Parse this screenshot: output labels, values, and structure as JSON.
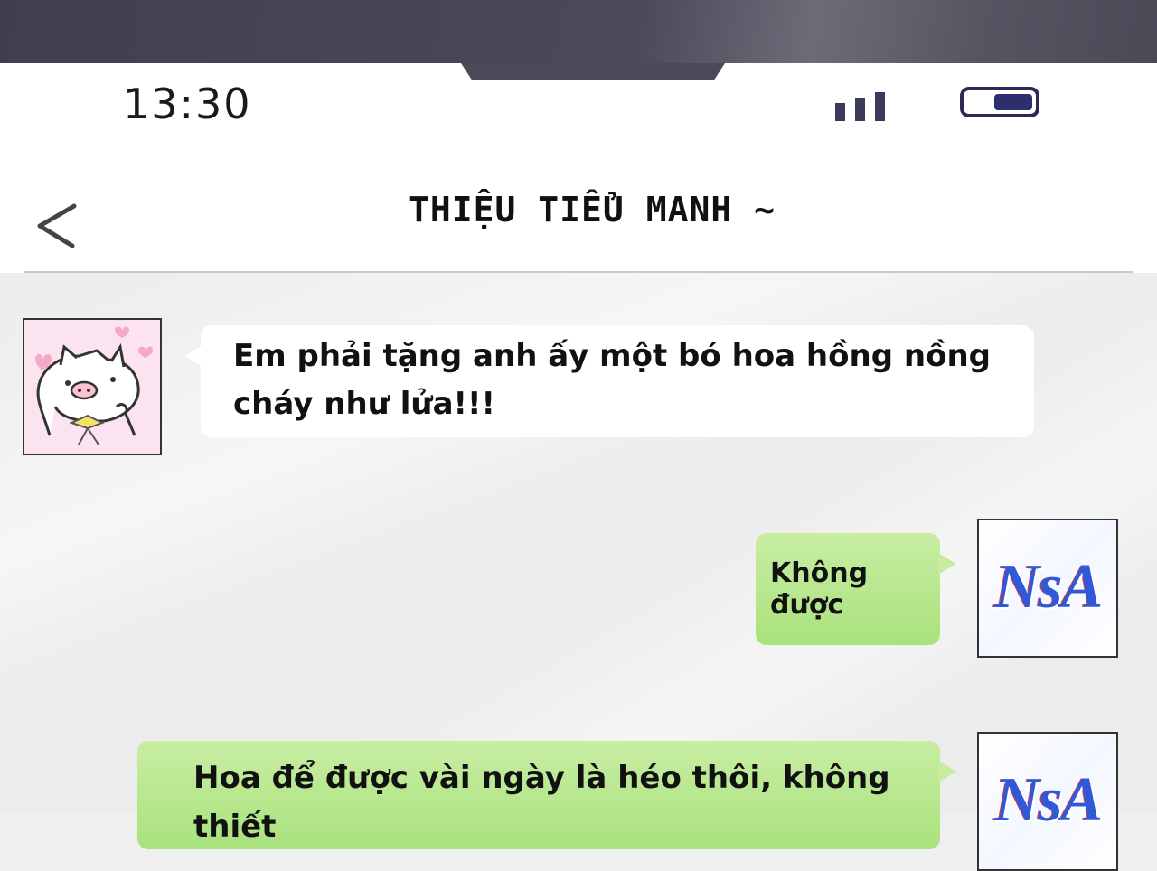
{
  "status_bar": {
    "time": "13:30",
    "icons": [
      "signal-icon",
      "battery-icon"
    ]
  },
  "header": {
    "title": "THIỆU TIỂU MANH ~",
    "back_icon": "chevron-left-icon"
  },
  "messages": [
    {
      "direction": "incoming",
      "avatar": "pig-avatar",
      "text": "Em phải tặng anh ấy một bó hoa hồng nồng cháy như lửa!!!"
    },
    {
      "direction": "outgoing",
      "avatar_text": "NsA",
      "text": "Không được"
    },
    {
      "direction": "outgoing",
      "avatar_text": "NsA",
      "text": "Hoa để được vài ngày là héo thôi, không thiết"
    }
  ],
  "colors": {
    "incoming_bubble": "#ffffff",
    "outgoing_bubble": "#b6e78c",
    "battery": "#2e2d6d",
    "frame": "#4a4a58"
  }
}
